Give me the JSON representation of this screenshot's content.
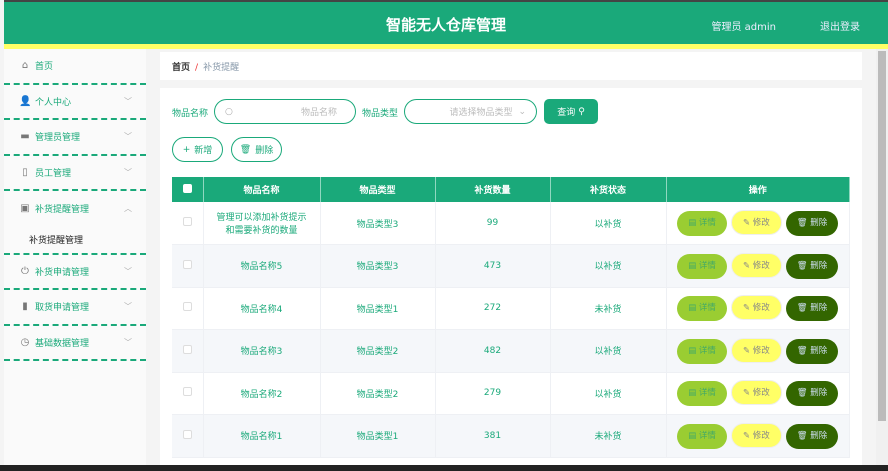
{
  "header": {
    "title": "智能无人仓库管理",
    "user": "管理员 admin",
    "logout": "退出登录"
  },
  "sidebar": {
    "items": [
      {
        "label": "首页",
        "icon": "home-icon"
      },
      {
        "label": "个人中心",
        "icon": "user-icon"
      },
      {
        "label": "管理员管理",
        "icon": "ticket-icon"
      },
      {
        "label": "员工管理",
        "icon": "microphone-icon"
      },
      {
        "label": "补货提醒管理",
        "icon": "clipboard-icon",
        "sub": "补货提醒管理"
      },
      {
        "label": "补货申请管理",
        "icon": "power-icon"
      },
      {
        "label": "取货申请管理",
        "icon": "bar-chart-icon"
      },
      {
        "label": "基础数据管理",
        "icon": "clock-icon"
      }
    ]
  },
  "breadcrumb": {
    "home": "首页",
    "sep": "/",
    "current": "补货提醒"
  },
  "search": {
    "name_label": "物品名称",
    "name_placeholder": "物品名称",
    "type_label": "物品类型",
    "type_placeholder": "请选择物品类型",
    "query": "查询"
  },
  "actions": {
    "add": "新增",
    "delete": "删除"
  },
  "table": {
    "headers": [
      "物品名称",
      "物品类型",
      "补货数量",
      "补货状态",
      "操作"
    ],
    "ops": {
      "detail": "详情",
      "edit": "修改",
      "delete": "删除"
    },
    "rows": [
      {
        "name": "管理可以添加补货提示 和需要补货的数量",
        "type": "物品类型3",
        "qty": "99",
        "status": "以补货"
      },
      {
        "name": "物品名称5",
        "type": "物品类型3",
        "qty": "473",
        "status": "以补货"
      },
      {
        "name": "物品名称4",
        "type": "物品类型1",
        "qty": "272",
        "status": "未补货"
      },
      {
        "name": "物品名称3",
        "type": "物品类型2",
        "qty": "482",
        "status": "以补货"
      },
      {
        "name": "物品名称2",
        "type": "物品类型2",
        "qty": "279",
        "status": "以补货"
      },
      {
        "name": "物品名称1",
        "type": "物品类型1",
        "qty": "381",
        "status": "未补货"
      }
    ]
  }
}
